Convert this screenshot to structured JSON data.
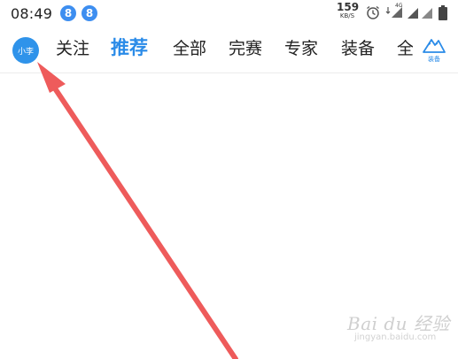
{
  "status_bar": {
    "time": "08:49",
    "notification_badges": [
      "8",
      "8"
    ],
    "network_speed": {
      "value": "159",
      "unit": "KB/S"
    },
    "network_type": "4G",
    "icons": [
      "alarm-icon",
      "wifi-icon",
      "signal-icon",
      "signal-icon",
      "battery-icon"
    ]
  },
  "nav": {
    "avatar_text": "小李",
    "tabs": [
      {
        "label": "关注",
        "active": false
      },
      {
        "label": "推荐",
        "active": true
      },
      {
        "label": "全部",
        "active": false
      },
      {
        "label": "完赛",
        "active": false
      },
      {
        "label": "专家",
        "active": false
      },
      {
        "label": "装备",
        "active": false
      },
      {
        "label": "全",
        "active": false
      }
    ],
    "gear_button_label": "装备"
  },
  "annotation": {
    "color": "#ee5b5b"
  },
  "watermark": {
    "brand": "Bai du 经验",
    "url": "jingyan.baidu.com"
  },
  "colors": {
    "accent": "#2a8be8",
    "badge": "#3d8ef0",
    "avatar": "#2f93ea",
    "arrow": "#ee5b5b"
  }
}
